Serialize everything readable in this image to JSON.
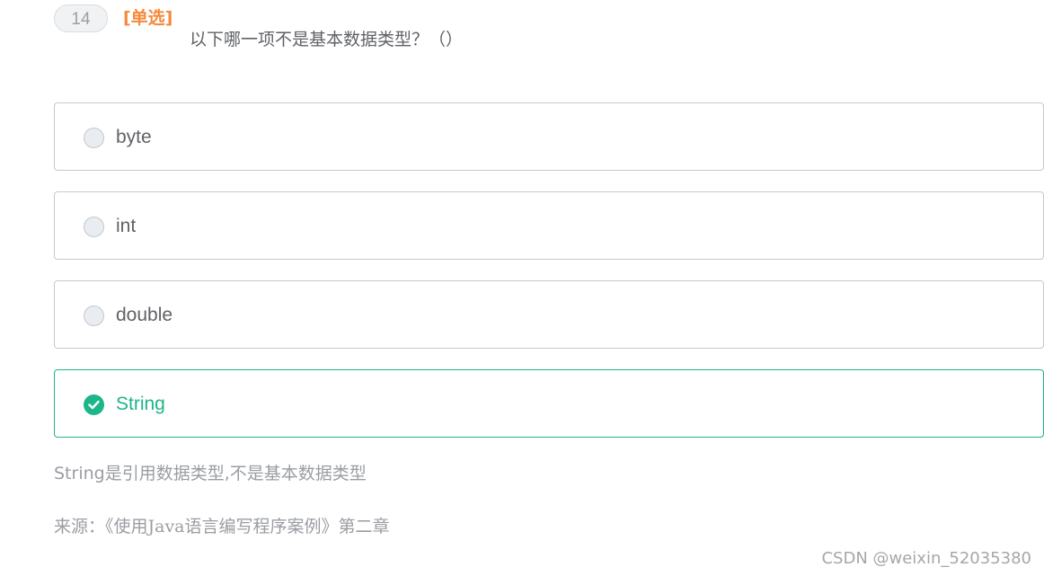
{
  "question": {
    "number": "14",
    "type_label": "[单选]",
    "text": "以下哪一项不是基本数据类型？（）"
  },
  "options": [
    {
      "label": "byte",
      "selected": false
    },
    {
      "label": "int",
      "selected": false
    },
    {
      "label": "double",
      "selected": false
    },
    {
      "label": "String",
      "selected": true
    }
  ],
  "explanation": "String是引用数据类型,不是基本数据类型",
  "source": "来源：《使用Java语言编写程序案例》第二章",
  "watermark": "CSDN @weixin_52035380",
  "colors": {
    "accent": "#1db58a",
    "type_label": "#f5893a",
    "border": "#c6c8cc",
    "text": "#606266",
    "muted": "#9a9da3"
  },
  "icons": {
    "unchecked": "radio-unchecked-icon",
    "checked": "check-circle-icon"
  }
}
